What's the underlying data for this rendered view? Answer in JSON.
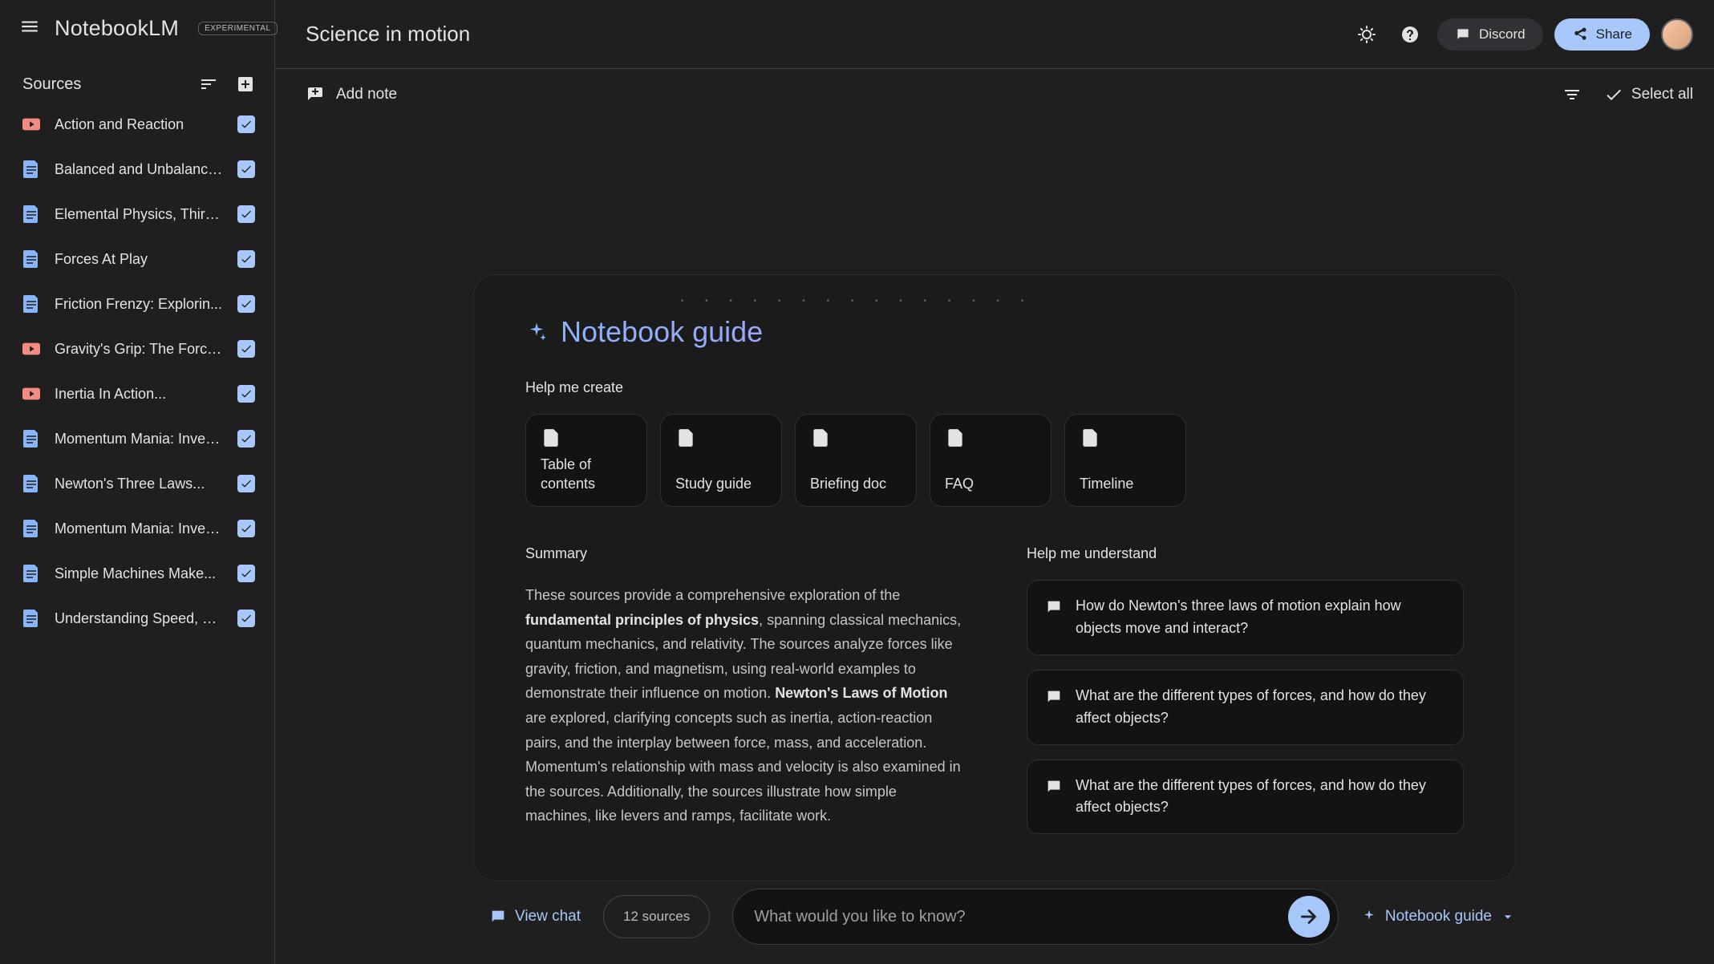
{
  "app": {
    "logo": "NotebookLM",
    "badge": "EXPERIMENTAL"
  },
  "topbar": {
    "title": "Science in motion",
    "discord": "Discord",
    "share": "Share"
  },
  "subbar": {
    "add_note": "Add note",
    "select_all": "Select all"
  },
  "sidebar": {
    "title": "Sources",
    "items": [
      {
        "type": "video",
        "label": "Action and Reaction",
        "checked": true
      },
      {
        "type": "article",
        "label": "Balanced and Unbalance...",
        "checked": true
      },
      {
        "type": "article",
        "label": "Elemental Physics, Third...",
        "checked": true
      },
      {
        "type": "article",
        "label": "Forces At Play",
        "checked": true
      },
      {
        "type": "article",
        "label": "Friction Frenzy: Explorin...",
        "checked": true
      },
      {
        "type": "video",
        "label": "Gravity's Grip: The Force...",
        "checked": true
      },
      {
        "type": "video",
        "label": "Inertia In Action...",
        "checked": true
      },
      {
        "type": "article",
        "label": "Momentum Mania: Investi...",
        "checked": true
      },
      {
        "type": "article",
        "label": "Newton's Three Laws...",
        "checked": true
      },
      {
        "type": "article",
        "label": "Momentum Mania: Investi...",
        "checked": true
      },
      {
        "type": "article",
        "label": "Simple Machines Make...",
        "checked": true
      },
      {
        "type": "article",
        "label": "Understanding Speed, Ve...",
        "checked": true
      }
    ]
  },
  "guide": {
    "title": "Notebook guide",
    "create_heading": "Help me create",
    "cards": [
      {
        "label": "Table of contents"
      },
      {
        "label": "Study guide"
      },
      {
        "label": "Briefing doc"
      },
      {
        "label": "FAQ"
      },
      {
        "label": "Timeline"
      }
    ],
    "summary_heading": "Summary",
    "summary_parts": {
      "p1": "These sources provide a comprehensive exploration of the ",
      "b1": "fundamental principles of physics",
      "p2": ", spanning classical mechanics, quantum mechanics, and relativity. The sources analyze forces like gravity, friction, and magnetism, using real-world examples to demonstrate their influence on motion. ",
      "b2": "Newton's Laws of Motion",
      "p3": " are explored, clarifying concepts such as inertia, action-reaction pairs, and the interplay between force, mass, and acceleration. Momentum's relationship with mass and velocity is also examined in the sources. Additionally, the sources illustrate how simple machines, like levers and ramps, facilitate work."
    },
    "understand_heading": "Help me understand",
    "questions": [
      "How do Newton's three laws of motion explain how objects move and interact?",
      "What are the different types of forces, and how do they affect objects?",
      "What are the different types of forces, and how do they affect objects?"
    ]
  },
  "dock": {
    "view_chat": "View chat",
    "source_count": "12 sources",
    "placeholder": "What would you like to know?",
    "nb_guide": "Notebook guide"
  }
}
